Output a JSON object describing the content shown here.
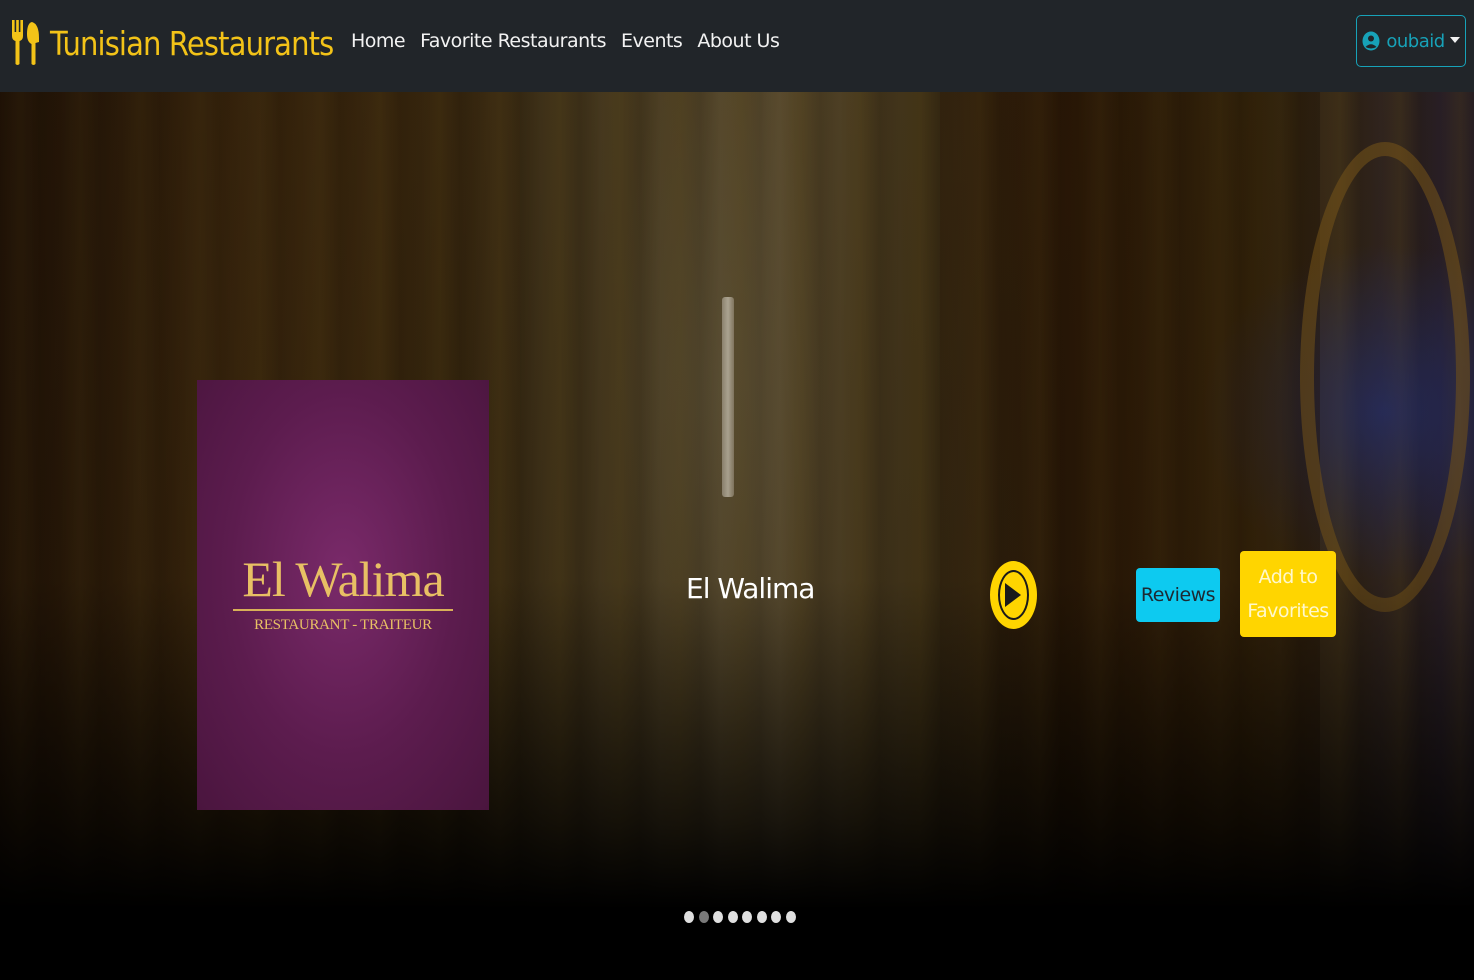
{
  "brand": {
    "name": "Tunisian Restaurants",
    "icon": "fork-knife-icon",
    "color": "#f3c318"
  },
  "nav": {
    "links": [
      {
        "label": "Home"
      },
      {
        "label": "Favorite Restaurants"
      },
      {
        "label": "Events"
      },
      {
        "label": "About Us"
      }
    ]
  },
  "user": {
    "name": "oubaid",
    "icon": "user-circle-icon",
    "color": "#17a2b8"
  },
  "carousel": {
    "slide": {
      "logo_title": "El Walima",
      "logo_subtitle": "RESTAURANT - TRAITEUR",
      "restaurant_name": "El Walima",
      "play_icon": "play-circle-icon",
      "reviews_label": "Reviews",
      "favorites_label": "Add to Favorites"
    },
    "indicator_count": 8,
    "active_index": 1
  },
  "colors": {
    "accent": "#ffd500",
    "info": "#0dcaf0",
    "navbar": "#212529"
  }
}
